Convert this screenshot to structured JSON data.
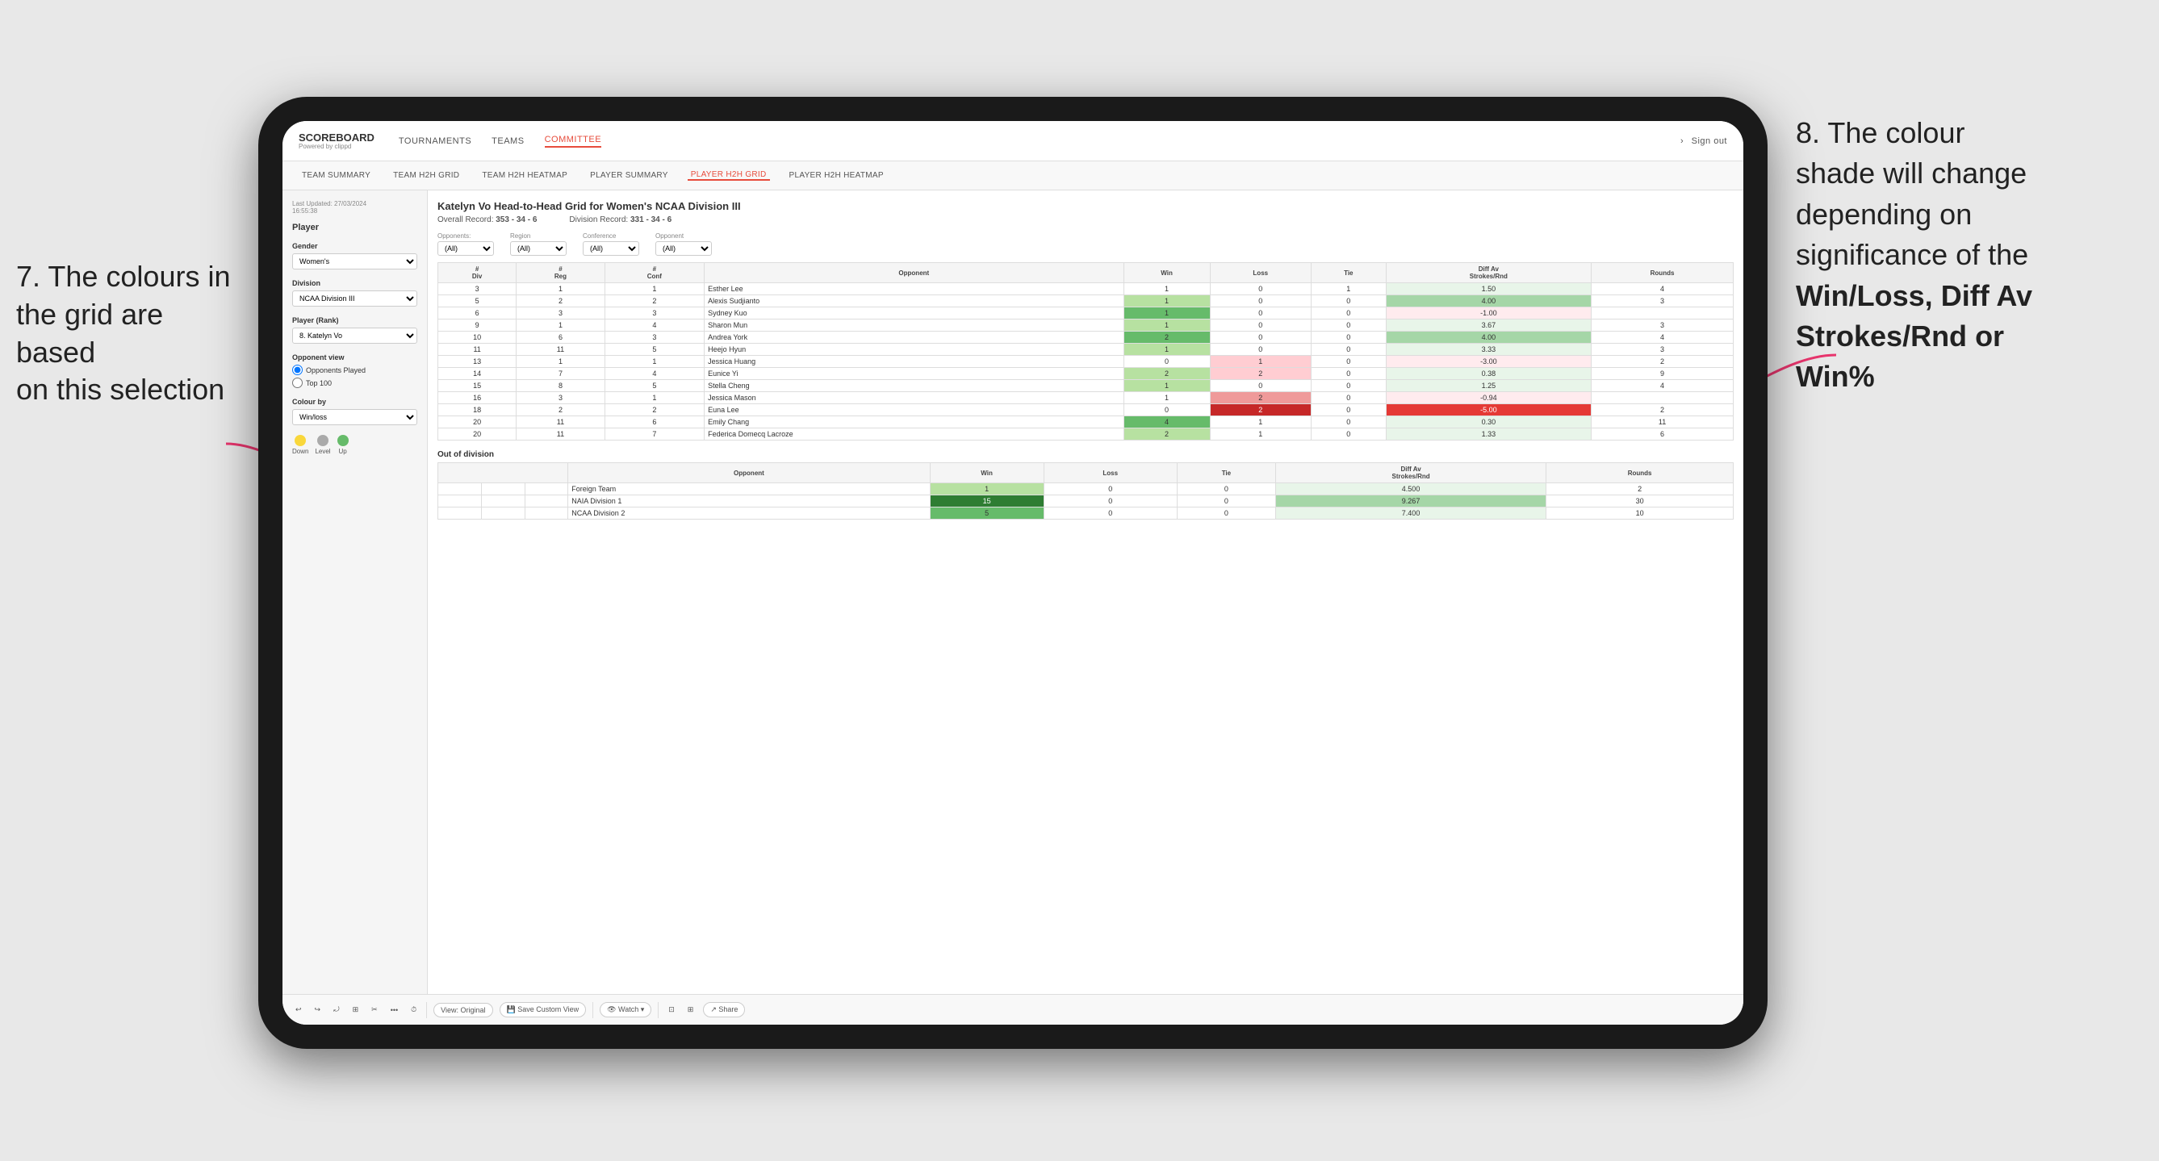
{
  "annotations": {
    "left_text_line1": "7. The colours in",
    "left_text_line2": "the grid are based",
    "left_text_line3": "on this selection",
    "right_text_line1": "8. The colour",
    "right_text_line2": "shade will change",
    "right_text_line3": "depending on",
    "right_text_line4": "significance of the",
    "right_text_bold1": "Win/Loss,",
    "right_text_bold2": "Diff Av",
    "right_text_bold3": "Strokes/Rnd",
    "right_text_bold4": "or",
    "right_text_bold5": "Win%"
  },
  "nav": {
    "logo": "SCOREBOARD",
    "logo_sub": "Powered by clippd",
    "links": [
      "TOURNAMENTS",
      "TEAMS",
      "COMMITTEE"
    ],
    "active_link": "COMMITTEE",
    "right_links": [
      "Sign out"
    ]
  },
  "sub_nav": {
    "links": [
      "TEAM SUMMARY",
      "TEAM H2H GRID",
      "TEAM H2H HEATMAP",
      "PLAYER SUMMARY",
      "PLAYER H2H GRID",
      "PLAYER H2H HEATMAP"
    ],
    "active_link": "PLAYER H2H GRID"
  },
  "sidebar": {
    "last_updated_label": "Last Updated: 27/03/2024",
    "last_updated_time": "16:55:38",
    "player_title": "Player",
    "gender_label": "Gender",
    "gender_value": "Women's",
    "division_label": "Division",
    "division_value": "NCAA Division III",
    "player_rank_label": "Player (Rank)",
    "player_rank_value": "8. Katelyn Vo",
    "opponent_view_title": "Opponent view",
    "opponent_played_label": "Opponents Played",
    "top100_label": "Top 100",
    "colour_by_label": "Colour by",
    "colour_by_value": "Win/loss",
    "legend_down": "Down",
    "legend_level": "Level",
    "legend_up": "Up"
  },
  "grid": {
    "title": "Katelyn Vo Head-to-Head Grid for Women's NCAA Division III",
    "overall_record_label": "Overall Record:",
    "overall_record_value": "353 - 34 - 6",
    "division_record_label": "Division Record:",
    "division_record_value": "331 - 34 - 6",
    "region_label": "Region",
    "conference_label": "Conference",
    "opponent_label": "Opponent",
    "opponents_label": "Opponents:",
    "opponents_value": "(All)",
    "region_filter": "(All)",
    "conference_filter": "(All)",
    "opponent_filter": "(All)",
    "col_headers": [
      "#\nDiv",
      "#\nReg",
      "#\nConf",
      "Opponent",
      "Win",
      "Loss",
      "Tie",
      "Diff Av\nStrokes/Rnd",
      "Rounds"
    ],
    "rows": [
      {
        "div": "3",
        "reg": "1",
        "conf": "1",
        "opponent": "Esther Lee",
        "win": "1",
        "loss": "0",
        "tie": "1",
        "diff": "1.50",
        "rounds": "4",
        "win_class": "neutral",
        "loss_class": "neutral",
        "diff_class": "diff_pos_light"
      },
      {
        "div": "5",
        "reg": "2",
        "conf": "2",
        "opponent": "Alexis Sudjianto",
        "win": "1",
        "loss": "0",
        "tie": "0",
        "diff": "4.00",
        "rounds": "3",
        "win_class": "win_green_light",
        "loss_class": "neutral",
        "diff_class": "diff_pos_med"
      },
      {
        "div": "6",
        "reg": "3",
        "conf": "3",
        "opponent": "Sydney Kuo",
        "win": "1",
        "loss": "0",
        "tie": "0",
        "diff": "-1.00",
        "rounds": "",
        "win_class": "win_green_med",
        "loss_class": "neutral",
        "diff_class": "diff_neg_light"
      },
      {
        "div": "9",
        "reg": "1",
        "conf": "4",
        "opponent": "Sharon Mun",
        "win": "1",
        "loss": "0",
        "tie": "0",
        "diff": "3.67",
        "rounds": "3",
        "win_class": "win_green_light",
        "loss_class": "neutral",
        "diff_class": "diff_pos_light"
      },
      {
        "div": "10",
        "reg": "6",
        "conf": "3",
        "opponent": "Andrea York",
        "win": "2",
        "loss": "0",
        "tie": "0",
        "diff": "4.00",
        "rounds": "4",
        "win_class": "win_green_med",
        "loss_class": "neutral",
        "diff_class": "diff_pos_med"
      },
      {
        "div": "11",
        "reg": "11",
        "conf": "5",
        "opponent": "Heejo Hyun",
        "win": "1",
        "loss": "0",
        "tie": "0",
        "diff": "3.33",
        "rounds": "3",
        "win_class": "win_green_light",
        "loss_class": "neutral",
        "diff_class": "diff_pos_light"
      },
      {
        "div": "13",
        "reg": "1",
        "conf": "1",
        "opponent": "Jessica Huang",
        "win": "0",
        "loss": "1",
        "tie": "0",
        "diff": "-3.00",
        "rounds": "2",
        "win_class": "neutral",
        "loss_class": "loss_red_light",
        "diff_class": "diff_neg_light"
      },
      {
        "div": "14",
        "reg": "7",
        "conf": "4",
        "opponent": "Eunice Yi",
        "win": "2",
        "loss": "2",
        "tie": "0",
        "diff": "0.38",
        "rounds": "9",
        "win_class": "win_green_light",
        "loss_class": "loss_red_light",
        "diff_class": "diff_pos_light"
      },
      {
        "div": "15",
        "reg": "8",
        "conf": "5",
        "opponent": "Stella Cheng",
        "win": "1",
        "loss": "0",
        "tie": "0",
        "diff": "1.25",
        "rounds": "4",
        "win_class": "win_green_light",
        "loss_class": "neutral",
        "diff_class": "diff_pos_light"
      },
      {
        "div": "16",
        "reg": "3",
        "conf": "1",
        "opponent": "Jessica Mason",
        "win": "1",
        "loss": "2",
        "tie": "0",
        "diff": "-0.94",
        "rounds": "",
        "win_class": "neutral",
        "loss_class": "loss_red_med",
        "diff_class": "diff_neg_light"
      },
      {
        "div": "18",
        "reg": "2",
        "conf": "2",
        "opponent": "Euna Lee",
        "win": "0",
        "loss": "2",
        "tie": "0",
        "diff": "-5.00",
        "rounds": "2",
        "win_class": "neutral",
        "loss_class": "loss_red_dark",
        "diff_class": "diff_neg_dark"
      },
      {
        "div": "20",
        "reg": "11",
        "conf": "6",
        "opponent": "Emily Chang",
        "win": "4",
        "loss": "1",
        "tie": "0",
        "diff": "0.30",
        "rounds": "11",
        "win_class": "win_green_med",
        "loss_class": "neutral",
        "diff_class": "diff_pos_light"
      },
      {
        "div": "20",
        "reg": "11",
        "conf": "7",
        "opponent": "Federica Domecq Lacroze",
        "win": "2",
        "loss": "1",
        "tie": "0",
        "diff": "1.33",
        "rounds": "6",
        "win_class": "win_green_light",
        "loss_class": "neutral",
        "diff_class": "diff_pos_light"
      }
    ],
    "out_of_division_label": "Out of division",
    "ood_rows": [
      {
        "opponent": "Foreign Team",
        "win": "1",
        "loss": "0",
        "tie": "0",
        "diff": "4.500",
        "rounds": "2",
        "win_class": "win_green_light",
        "diff_class": "diff_pos_light"
      },
      {
        "opponent": "NAIA Division 1",
        "win": "15",
        "loss": "0",
        "tie": "0",
        "diff": "9.267",
        "rounds": "30",
        "win_class": "win_green_dark",
        "diff_class": "diff_pos_med"
      },
      {
        "opponent": "NCAA Division 2",
        "win": "5",
        "loss": "0",
        "tie": "0",
        "diff": "7.400",
        "rounds": "10",
        "win_class": "win_green_med",
        "diff_class": "diff_pos_light"
      }
    ]
  },
  "toolbar": {
    "buttons": [
      "↩",
      "↪",
      "⤾",
      "⊞",
      "✂",
      "·",
      "⏱",
      "|",
      "View: Original",
      "Save Custom View",
      "|",
      "👁 Watch ▾",
      "|",
      "⊡",
      "⊞",
      "Share"
    ]
  },
  "colors": {
    "accent_red": "#e74c3c",
    "win_green_light": "#b7e1a1",
    "win_green_med": "#66bb6a",
    "win_green_dark": "#2e7d32",
    "loss_red_light": "#ffcdd2",
    "loss_red_med": "#ef9a9a",
    "loss_red_dark": "#c62828",
    "diff_pos_light": "#e8f5e9",
    "diff_pos_med": "#a5d6a7",
    "diff_neg_light": "#ffebee",
    "diff_neg_dark": "#e53935",
    "legend_yellow": "#f9d73b",
    "legend_gray": "#aaa",
    "legend_green": "#66bb6a"
  }
}
